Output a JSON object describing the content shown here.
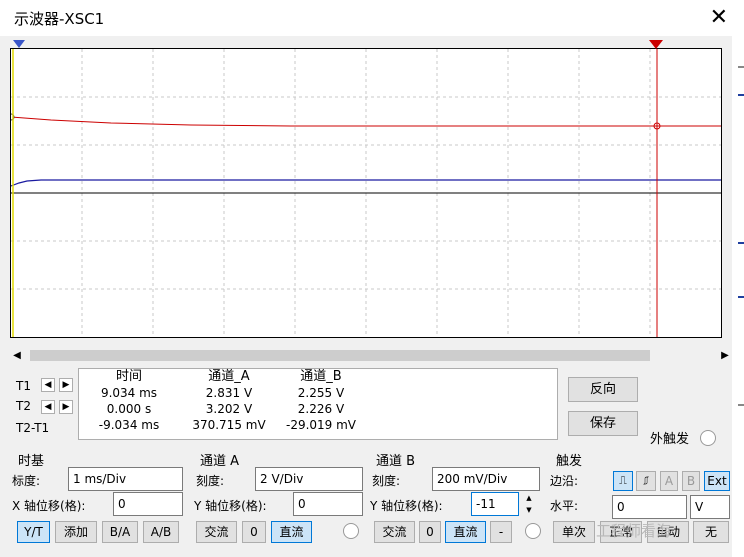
{
  "window": {
    "title": "示波器-XSC1",
    "close_icon": "close-icon"
  },
  "colors": {
    "channel_a": "#cc0000",
    "channel_b": "#1a1aa0",
    "t1_cursor": "#e0d800",
    "t2_cursor": "#cc0000"
  },
  "readout": {
    "row_labels": [
      "T1",
      "T2",
      "T2-T1"
    ],
    "headers": {
      "time": "时间",
      "a": "通道_A",
      "b": "通道_B"
    },
    "time": [
      "9.034 ms",
      "0.000 s",
      "-9.034 ms"
    ],
    "a": [
      "2.831 V",
      "3.202 V",
      "370.715 mV"
    ],
    "b": [
      "2.255 V",
      "2.226 V",
      "-29.019 mV"
    ]
  },
  "buttons": {
    "reverse": "反向",
    "save": "保存",
    "ext_trigger": "外触发"
  },
  "timebase": {
    "header": "时基",
    "scale_label": "标度:",
    "scale_value": "1 ms/Div",
    "xpos_label": "X 轴位移(格):",
    "xpos_value": "0",
    "modes": [
      "Y/T",
      "添加",
      "B/A",
      "A/B"
    ]
  },
  "channel_a": {
    "header": "通道 A",
    "scale_label": "刻度:",
    "scale_value": "2  V/Div",
    "ypos_label": "Y 轴位移(格):",
    "ypos_value": "0",
    "coupling": [
      "交流",
      "0",
      "直流"
    ]
  },
  "channel_b": {
    "header": "通道 B",
    "scale_label": "刻度:",
    "scale_value": "200 mV/Div",
    "ypos_label": "Y 轴位移(格):",
    "ypos_value": "-11",
    "coupling": [
      "交流",
      "0",
      "直流",
      "-"
    ]
  },
  "trigger": {
    "header": "触发",
    "edge_label": "边沿:",
    "edge_buttons": [
      "A",
      "B",
      "Ext"
    ],
    "level_label": "水平:",
    "level_value": "0",
    "level_unit": "V",
    "modes": [
      "单次",
      "正常",
      "自动",
      "无"
    ]
  },
  "watermark": "工程师看海"
}
